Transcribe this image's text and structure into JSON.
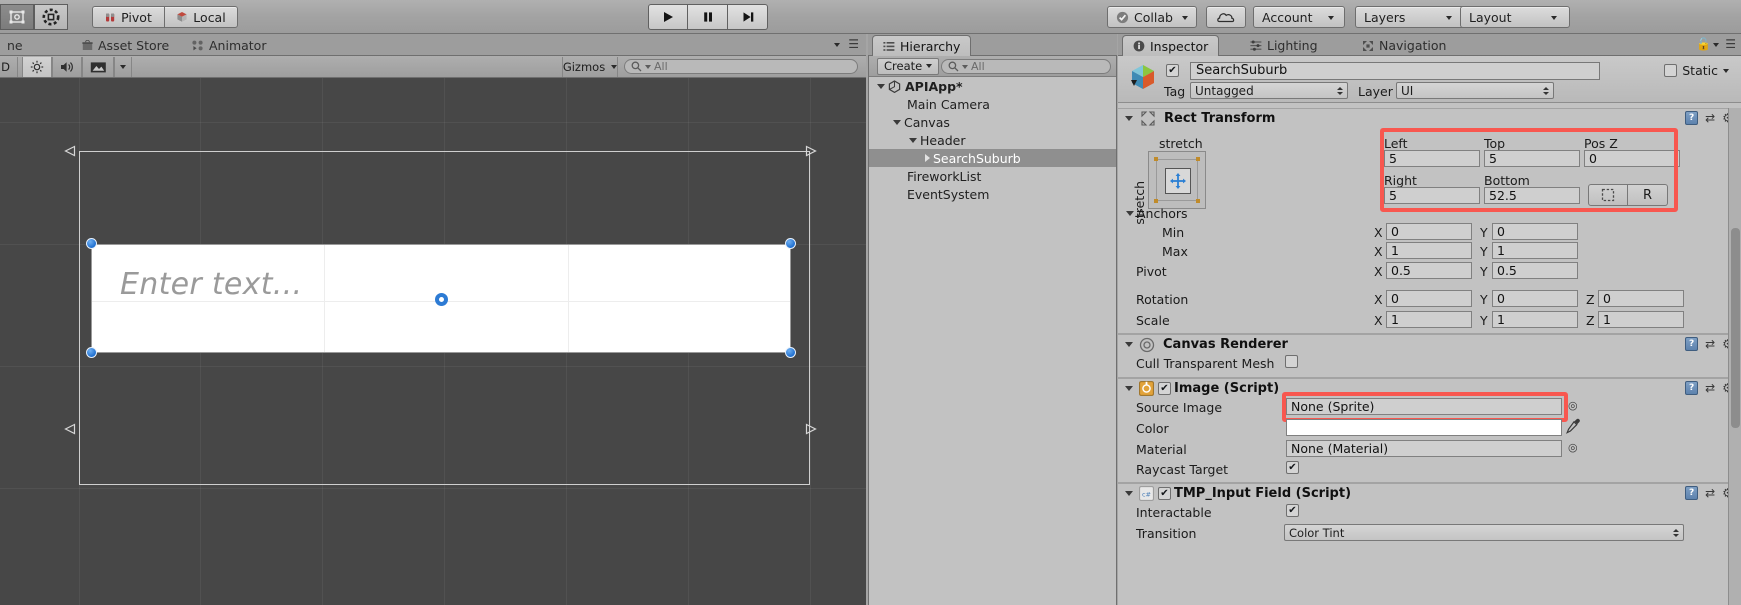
{
  "toolbar": {
    "tools": [
      {
        "name": "rect-tool",
        "icon": "rect-transform-icon",
        "selected": false
      },
      {
        "name": "transform-tool",
        "icon": "move-rotate-scale-icon",
        "selected": true
      }
    ],
    "pivot_label": "Pivot",
    "pivot_icon": "pivot-icon",
    "local_label": "Local",
    "local_icon": "local-space-icon",
    "play_label": "play-icon",
    "pause_label": "pause-icon",
    "step_label": "step-icon",
    "collab_label": "Collab",
    "collab_icon": "collab-check-icon",
    "cloud_icon": "cloud-icon",
    "account_label": "Account",
    "layers_label": "Layers",
    "layout_label": "Layout"
  },
  "tabs": {
    "left": [
      {
        "label": "ne",
        "icon": "game-view-icon",
        "active": false
      },
      {
        "label": "Asset Store",
        "icon": "asset-store-icon",
        "active": false
      },
      {
        "label": "Animator",
        "icon": "animator-icon",
        "active": false
      }
    ],
    "hierarchy": {
      "label": "Hierarchy",
      "icon": "hierarchy-icon",
      "active": true
    },
    "right": [
      {
        "label": "Inspector",
        "icon": "inspector-info-icon",
        "active": true
      },
      {
        "label": "Lighting",
        "icon": "lighting-icon",
        "active": false
      },
      {
        "label": "Navigation",
        "icon": "navigation-icon",
        "active": false
      }
    ]
  },
  "scene": {
    "toolbar": {
      "mode_label": "D",
      "lighting_icon": "sun-icon",
      "audio_icon": "speaker-icon",
      "fx_icon": "image-fx-icon",
      "fx_dropdown_icon": "chevron-down-icon",
      "gizmos_label": "Gizmos",
      "search_placeholder": "All",
      "search_icon": "search-icon"
    },
    "input_field_placeholder": "Enter text...",
    "selection_handles": 4,
    "pivot_marker": "pivot-handle"
  },
  "hierarchy": {
    "create_label": "Create",
    "search_placeholder": "All",
    "search_icon": "search-icon",
    "items": [
      {
        "label": "APIApp*",
        "depth": 0,
        "expanded": true,
        "icon": "unity-scene-icon",
        "bold": true,
        "selected": false
      },
      {
        "label": "Main Camera",
        "depth": 1,
        "expanded": null,
        "icon": null,
        "bold": false,
        "selected": false
      },
      {
        "label": "Canvas",
        "depth": 1,
        "expanded": true,
        "icon": null,
        "bold": false,
        "selected": false
      },
      {
        "label": "Header",
        "depth": 2,
        "expanded": true,
        "icon": null,
        "bold": false,
        "selected": false
      },
      {
        "label": "SearchSuburb",
        "depth": 3,
        "expanded": false,
        "icon": null,
        "bold": false,
        "selected": true
      },
      {
        "label": "FireworkList",
        "depth": 1,
        "expanded": null,
        "icon": null,
        "bold": false,
        "selected": false
      },
      {
        "label": "EventSystem",
        "depth": 1,
        "expanded": null,
        "icon": null,
        "bold": false,
        "selected": false
      }
    ]
  },
  "inspector": {
    "object_name": "SearchSuburb",
    "object_enabled": true,
    "static_label": "Static",
    "static_checked": false,
    "tag_label": "Tag",
    "tag_value": "Untagged",
    "layer_label": "Layer",
    "layer_value": "UI",
    "rect_transform": {
      "title": "Rect Transform",
      "anchor_preset_label_top": "stretch",
      "anchor_preset_label_left": "stretch",
      "left_label": "Left",
      "left_value": "5",
      "top_label": "Top",
      "top_value": "5",
      "posz_label": "Pos Z",
      "posz_value": "0",
      "right_label": "Right",
      "right_value": "5",
      "bottom_label": "Bottom",
      "bottom_value": "52.5",
      "blueprint_button": "blueprint-mode-icon",
      "raw_button": "R",
      "anchors_label": "Anchors",
      "min_label": "Min",
      "min_x": "0",
      "min_y": "0",
      "max_label": "Max",
      "max_x": "1",
      "max_y": "1",
      "pivot_label": "Pivot",
      "pivot_x": "0.5",
      "pivot_y": "0.5",
      "rotation_label": "Rotation",
      "rotation_x": "0",
      "rotation_y": "0",
      "rotation_z": "0",
      "scale_label": "Scale",
      "scale_x": "1",
      "scale_y": "1",
      "scale_z": "1",
      "axis_x": "X",
      "axis_y": "Y",
      "axis_z": "Z"
    },
    "canvas_renderer": {
      "title": "Canvas Renderer",
      "cull_label": "Cull Transparent Mesh",
      "cull_checked": false
    },
    "image_script": {
      "title": "Image (Script)",
      "enabled": true,
      "source_image_label": "Source Image",
      "source_image_value": "None (Sprite)",
      "color_label": "Color",
      "color_value": "#FFFFFF",
      "material_label": "Material",
      "material_value": "None (Material)",
      "raycast_label": "Raycast Target",
      "raycast_checked": true,
      "eyedropper_icon": "eyedropper-icon",
      "object_picker_icon": "object-picker-icon"
    },
    "tmp_input_field": {
      "title": "TMP_Input Field (Script)",
      "enabled": true,
      "interactable_label": "Interactable",
      "interactable_checked": true,
      "transition_label": "Transition",
      "transition_value": "Color Tint"
    },
    "highlight_color": "#F8574F"
  }
}
